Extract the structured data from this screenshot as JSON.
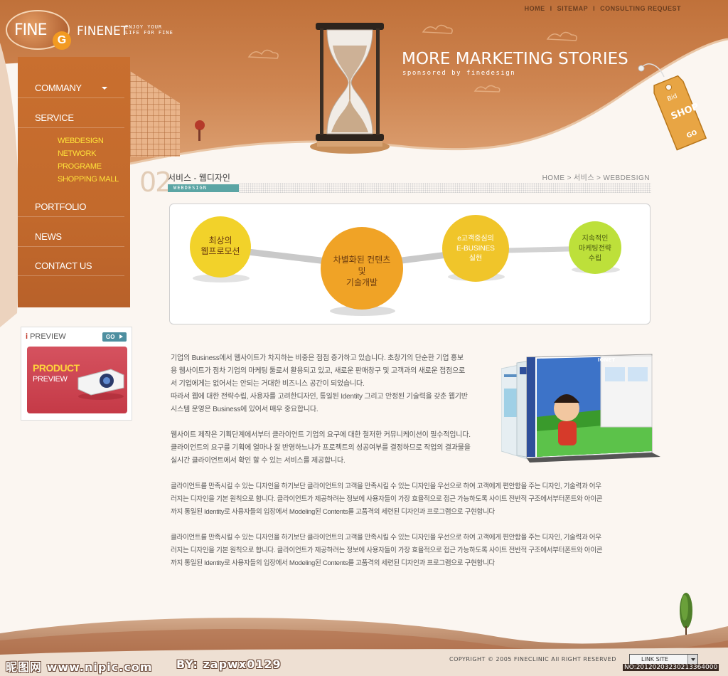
{
  "brand": {
    "logo_text": "FINE",
    "logo_letter": "G",
    "name": "FINENET",
    "tagline": "ENJOY YOUR LIFE FOR FINE"
  },
  "top_nav": [
    {
      "label": "HOME"
    },
    {
      "label": "SITEMAP"
    },
    {
      "label": "CONSULTING REQUEST"
    }
  ],
  "hero": {
    "headline": "MORE MARKETING STORIES",
    "subheadline": "sponsored by finedesign",
    "tag_small": "Bid",
    "tag_shop": "SHOP",
    "tag_go": "GO"
  },
  "sidebar": {
    "items": [
      {
        "label": "COMMANY"
      },
      {
        "label": "SERVICE"
      },
      {
        "label": "PORTFOLIO"
      },
      {
        "label": "NEWS"
      },
      {
        "label": "CONTACT US"
      }
    ],
    "sub_items": [
      {
        "label": "WEBDESIGN"
      },
      {
        "label": "NETWORK"
      },
      {
        "label": "PROGRAME"
      },
      {
        "label": "SHOPPING MALL"
      }
    ]
  },
  "preview": {
    "marker": "i",
    "title": "PREVIEW",
    "go_label": "GO",
    "banner_line1": "PRODUCT",
    "banner_line2": "PREVIEW"
  },
  "section": {
    "number": "02",
    "title": "서비스 - 웹디자인",
    "badge": "WEBDESIGN",
    "breadcrumb": [
      "HOME",
      "서비스",
      "WEBDESIGN"
    ]
  },
  "diagram": {
    "nodes": [
      {
        "lines": [
          "최상의",
          "웹프로모션"
        ],
        "color": "#f2d22a"
      },
      {
        "lines": [
          "차별화된 컨텐츠",
          "및",
          "기술개발"
        ],
        "color": "#f0a326"
      },
      {
        "lines": [
          "e고객중심의",
          "E-BUSINES",
          "실현"
        ],
        "color": "#f0c52a"
      },
      {
        "lines": [
          "지속적인",
          "마케팅전략",
          "수립"
        ],
        "color": "#bde03a"
      }
    ]
  },
  "body": {
    "paragraph1": [
      "기업의 Business에서 웹사이트가 차지하는 비중은 점점 증가하고 있습니다.  초창기의 단순한 기업 홍보",
      "용 웹사이트가 점차 기업의 마케팅 툴로서 활용되고 있고, 새로운 판매창구 및 고객과의 새로운 접점으로",
      "서 기업에게는 없어서는 안되는 거대한 비즈니스 공간이 되었습니다.",
      "따라서 웹에 대한 전략수립, 사용자를 고려한디자인, 통일된 Identity 그리고 안정된 기술력을 갖춘 웹기반",
      "시스템 운영은 Business에 있어서 매우 중요합니다."
    ],
    "paragraph2": [
      "웹사이트 제작은 기획단계에서부터 클라이언트 기업의 요구에 대한 철저한 커뮤니케이션이 필수적입니다.",
      "클라이언트의 요구를 기획에 얼마나 잘 반영하느냐가 프로젝트의 성공여부를 결정하므로 작업의 결과물을",
      "실시간 클라이언트에서 확인 할 수 있는 서비스를 제공합니다."
    ],
    "paragraph3": [
      "클라이언트를 만족시킬 수 있는 디자인을 하기보단 클라이언트의 고객을 만족시킬 수 있는 디자인을 우선으로 하여 고객에게 편안함을 주는 디자인, 기술력과 어우",
      "러지는 디자인을 기본 원칙으로 합니다. 클라이언트가 제공하려는 정보에 사용자들이 가장 효율적으로 접근 가능하도록 사이트 전반적 구조에서부터폰트와 아이콘",
      "까지 통일된 Identity로 사용자들의 입장에서 Modeling된 Contents를 고품격의 세련된 디자인과 프로그램으로 구현합니다"
    ],
    "paragraph4": [
      "클라이언트를 만족시킬 수 있는 디자인을 하기보단 클라이언트의 고객을 만족시킬 수 있는 디자인을 우선으로 하여 고객에게 편안함을 주는 디자인, 기술력과 어우",
      "러지는 디자인을 기본 원칙으로 합니다. 클라이언트가 제공하려는 정보에 사용자들이 가장 효율적으로 접근 가능하도록 사이트 전반적 구조에서부터폰트와 아이콘",
      "까지 통일된 Identity로 사용자들의 입장에서 Modeling된 Contents를 고품격의 세련된 디자인과 프로그램으로 구현합니다"
    ],
    "screenshot_brand": "IONET"
  },
  "footer": {
    "copyright": "COPYRIGHT © 2005 FINECLINIC  All RIGHT RESERVED",
    "link_site": "LINK SITE",
    "watermark": "昵图网 www.nipic.com",
    "watermark_by": "BY: zapwx0129",
    "image_id": "NO:20120203230213364000"
  },
  "colors": {
    "brand_orange": "#c96f2f",
    "accent_teal": "#5ba5a4",
    "nav_sub_yellow": "#ffe23a"
  }
}
